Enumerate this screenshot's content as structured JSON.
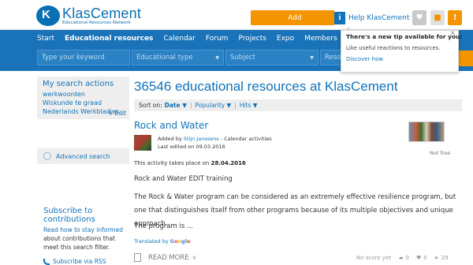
{
  "header": {
    "logo_name": "KlasCement",
    "logo_sub": "Educational Resources Network",
    "add_label": "Add",
    "help_label": "Help KlasCement"
  },
  "nav": {
    "items": [
      "Start",
      "Educational resources",
      "Calendar",
      "Forum",
      "Projects",
      "Expo",
      "Members"
    ],
    "active": "Educational resources"
  },
  "filters": {
    "keyword_placeholder": "Type your keyword",
    "type_placeholder": "Educational type",
    "subject_placeholder": "Subject",
    "resource_placeholder": "Resou"
  },
  "popup": {
    "title": "There's a new tip available for you:",
    "text": "Like useful reactions to resources.",
    "link": "Discover how"
  },
  "sidebar": {
    "actions_title": "My search actions",
    "actions": [
      "werkwoorden",
      "Wiskunde te graad",
      "Nederlands Werkbladjes"
    ],
    "edit_label": "Edit",
    "advanced_label": "Advanced search",
    "subscribe_title": "Subscribe to contributions",
    "subscribe_link": "Read how to stay informed",
    "subscribe_rest": " about contributions that meet this search filter.",
    "rss_label": "Subscribe via RSS"
  },
  "main": {
    "title": "36546 educational resources at KlasCement",
    "sort_label": "Sort on:",
    "sort_active": "Date",
    "sort_options": [
      "Popularity",
      "Hits"
    ]
  },
  "resource": {
    "title": "Rock and Water",
    "added_prefix": "Added by ",
    "added_by": "Stijn Janssens",
    "added_suffix": " - Calendar activities",
    "edited": "Last edited on 09.03.2016",
    "price": "Not free",
    "date_prefix": "This activity takes place on ",
    "date": "28.04.2016",
    "subtitle": "Rock and Water EDIT training",
    "description": "The Rock & Water program can be considered as an extremely effective resilience program, but one that distinguishes itself from other programs because of its multiple objectives and unique approach.",
    "more_text": "The program is ...",
    "translated_prefix": "Translated by",
    "read_more": "READ MORE",
    "score": "No score yet",
    "comments": "0",
    "likes": "0",
    "hits": "29"
  }
}
